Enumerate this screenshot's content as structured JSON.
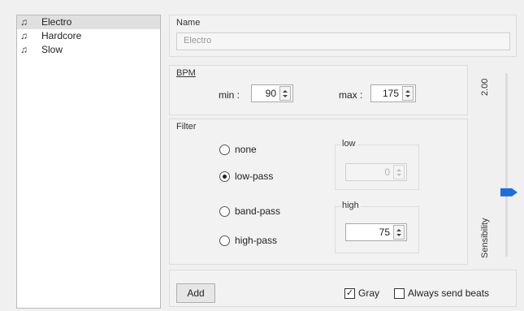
{
  "presets": {
    "items": [
      {
        "label": "Electro",
        "icon": "music-note-icon",
        "selected": true
      },
      {
        "label": "Hardcore",
        "icon": "music-note-icon",
        "selected": false
      },
      {
        "label": "Slow",
        "icon": "music-note-icon",
        "selected": false
      }
    ]
  },
  "name_group": {
    "title": "Name",
    "value": "Electro"
  },
  "bpm": {
    "title": "BPM",
    "min_label": "min :",
    "min_value": "90",
    "max_label": "max :",
    "max_value": "175"
  },
  "filter": {
    "title": "Filter",
    "options": [
      {
        "label": "none",
        "checked": false
      },
      {
        "label": "low-pass",
        "checked": true
      },
      {
        "label": "band-pass",
        "checked": false
      },
      {
        "label": "high-pass",
        "checked": false
      }
    ],
    "low": {
      "title": "low",
      "value": "0",
      "enabled": false
    },
    "high": {
      "title": "high",
      "value": "75",
      "enabled": true
    }
  },
  "sensibility": {
    "label": "Sensibility",
    "value_text": "2.00",
    "level": 0.35,
    "handle_color": "#1e6fd9"
  },
  "bottom": {
    "add_label": "Add",
    "gray": {
      "label": "Gray",
      "checked": true
    },
    "always_send": {
      "label": "Always send beats",
      "checked": false
    }
  }
}
